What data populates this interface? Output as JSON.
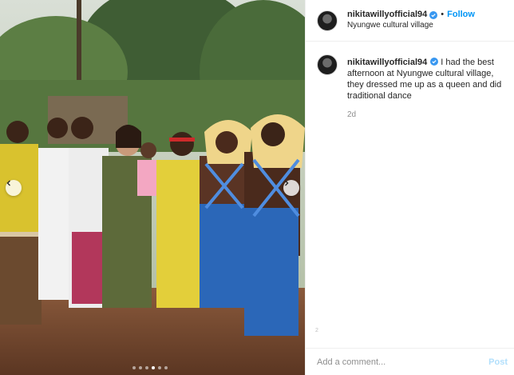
{
  "colors": {
    "accent": "#0095f6",
    "verified": "#3897f0",
    "muted": "#8e8e8e",
    "post_disabled": "#b2dffc"
  },
  "header": {
    "username": "nikitawillyofficial94",
    "separator": "•",
    "follow_label": "Follow",
    "location": "Nyungwe cultural village",
    "verified_icon": "verified-badge-icon"
  },
  "caption": {
    "username": "nikitawillyofficial94",
    "text": "I had the best afternoon at Nyungwe cultural village, they dressed me up as a queen and did traditional dance",
    "time": "2d"
  },
  "scroll_marker": "2",
  "comment_box": {
    "placeholder": "Add a comment...",
    "post_label": "Post"
  },
  "carousel": {
    "prev_icon": "chevron-left-icon",
    "next_icon": "chevron-right-icon",
    "slide_count": 6,
    "active_index": 3
  }
}
